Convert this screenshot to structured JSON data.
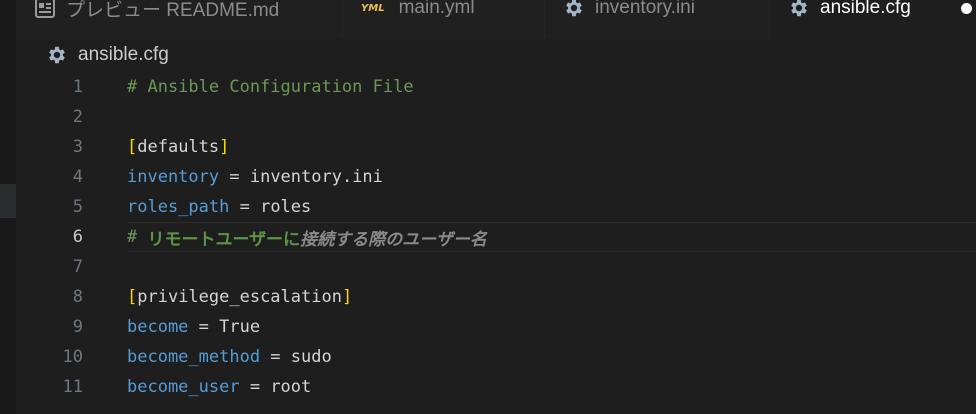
{
  "tabs": [
    {
      "label": "プレビュー README.md",
      "icon": "preview-icon",
      "active": false
    },
    {
      "label": "main.yml",
      "icon": "yaml-icon",
      "icon_text": "YML",
      "active": false
    },
    {
      "label": "inventory.ini",
      "icon": "gear-icon",
      "active": false
    },
    {
      "label": "ansible.cfg",
      "icon": "gear-icon",
      "active": true,
      "dirty": true
    }
  ],
  "breadcrumb": {
    "label": "ansible.cfg",
    "icon": "gear-icon"
  },
  "colors": {
    "comment": "#6a9955",
    "bracket": "#ffd700",
    "key": "#569cd6",
    "text": "#d4d4d4",
    "yaml_icon": "#e8c547",
    "gear_icon": "#a3b5c6"
  },
  "editor": {
    "current_line": 6,
    "lines": [
      {
        "n": "1",
        "parts": [
          {
            "t": "# Ansible Configuration File",
            "c": "comment"
          }
        ]
      },
      {
        "n": "2",
        "parts": []
      },
      {
        "n": "3",
        "parts": [
          {
            "t": "[",
            "c": "bracket"
          },
          {
            "t": "defaults",
            "c": "plain"
          },
          {
            "t": "]",
            "c": "bracket"
          }
        ]
      },
      {
        "n": "4",
        "parts": [
          {
            "t": "inventory",
            "c": "key"
          },
          {
            "t": " = ",
            "c": "op"
          },
          {
            "t": "inventory.ini",
            "c": "plain"
          }
        ]
      },
      {
        "n": "5",
        "parts": [
          {
            "t": "roles_path",
            "c": "key"
          },
          {
            "t": " = ",
            "c": "op"
          },
          {
            "t": "roles",
            "c": "plain"
          }
        ]
      },
      {
        "n": "6",
        "parts": [
          {
            "t": "# ",
            "c": "comment"
          },
          {
            "t": "リモートユーザーに",
            "c": "jp-comment"
          },
          {
            "t": "接続する際のユーザー名",
            "c": "jp-italic"
          }
        ]
      },
      {
        "n": "7",
        "parts": []
      },
      {
        "n": "8",
        "parts": [
          {
            "t": "[",
            "c": "bracket"
          },
          {
            "t": "privilege_escalation",
            "c": "plain"
          },
          {
            "t": "]",
            "c": "bracket"
          }
        ]
      },
      {
        "n": "9",
        "parts": [
          {
            "t": "become",
            "c": "key"
          },
          {
            "t": " = ",
            "c": "op"
          },
          {
            "t": "True",
            "c": "plain"
          }
        ]
      },
      {
        "n": "10",
        "parts": [
          {
            "t": "become_method",
            "c": "key"
          },
          {
            "t": " = ",
            "c": "op"
          },
          {
            "t": "sudo",
            "c": "plain"
          }
        ]
      },
      {
        "n": "11",
        "parts": [
          {
            "t": "become_user",
            "c": "key"
          },
          {
            "t": " = ",
            "c": "op"
          },
          {
            "t": "root",
            "c": "plain"
          }
        ]
      }
    ]
  }
}
